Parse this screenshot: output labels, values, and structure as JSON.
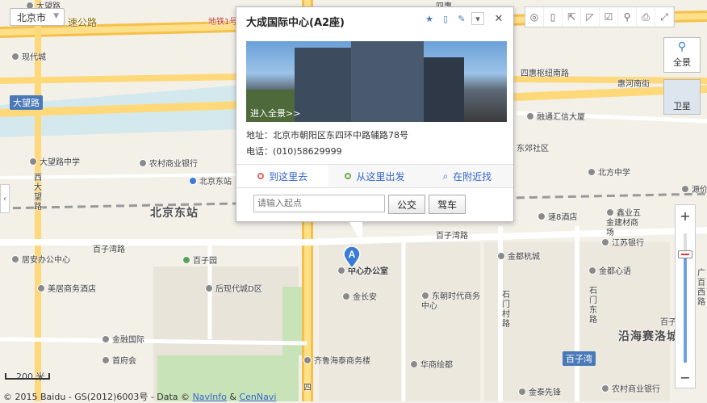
{
  "map": {
    "roads": [
      {
        "name": "大望路",
        "type": "shield-blue"
      },
      {
        "name": "西大望路",
        "type": "vertical"
      },
      {
        "name": "速公路",
        "type": "highway"
      },
      {
        "name": "惠河南街",
        "type": "street"
      },
      {
        "name": "百子湾路",
        "type": "street"
      },
      {
        "name": "百子湾路",
        "type": "street"
      },
      {
        "name": "四惠枢纽南路",
        "type": "street"
      },
      {
        "name": "石门村路",
        "type": "vertical"
      },
      {
        "name": "石门东路",
        "type": "vertical"
      },
      {
        "name": "四",
        "type": "vertical"
      }
    ],
    "districts": [
      {
        "name": "北京东站"
      },
      {
        "name": "沿海赛洛城"
      },
      {
        "name": "百子湾",
        "type": "shield-blue"
      }
    ],
    "pois": [
      {
        "name": "大望路"
      },
      {
        "name": "现代城"
      },
      {
        "name": "大望路中学"
      },
      {
        "name": "农村商业银行"
      },
      {
        "name": "北京东站"
      },
      {
        "name": "百子园"
      },
      {
        "name": "居安办公中心"
      },
      {
        "name": "美居商务酒店"
      },
      {
        "name": "后现代城D区"
      },
      {
        "name": "金融国际"
      },
      {
        "name": "首府会"
      },
      {
        "name": "金长安"
      },
      {
        "name": "东朝时代商务中心"
      },
      {
        "name": "齐鲁海泰商务楼"
      },
      {
        "name": "华商绘都"
      },
      {
        "name": "金都杭城"
      },
      {
        "name": "金都心语"
      },
      {
        "name": "江苏银行"
      },
      {
        "name": "金泰先锋"
      },
      {
        "name": "农村商业银行"
      },
      {
        "name": "速8酒店"
      },
      {
        "name": "鑫业五金建材商场"
      },
      {
        "name": "北方中学"
      },
      {
        "name": "融通汇信大厦"
      },
      {
        "name": "东郊社区"
      },
      {
        "name": "源价"
      },
      {
        "name": "广百西路"
      },
      {
        "name": "百子"
      },
      {
        "name": "中心办公室"
      },
      {
        "name": "四惠"
      },
      {
        "name": "地铁1号"
      }
    ],
    "city_select": "北京市",
    "scale_label": "200 米",
    "copyright_prefix": "© 2015 Baidu - GS(2012)6003号 - Data ©",
    "copyright_link1": "NavInfo",
    "copyright_amp": "&",
    "copyright_link2": "CenNavi"
  },
  "popup": {
    "title": "大成国际中心(A2座)",
    "pano_label": "进入全景>>",
    "address_label": "地址：",
    "address": "北京市朝阳区东四环中路辅路78号",
    "phone_label": "电话：",
    "phone": "(010)58629999",
    "tabs": [
      {
        "label": "到这里去",
        "color": "#e06666"
      },
      {
        "label": "从这里出发",
        "color": "#6ab04c"
      },
      {
        "label": "在附近找",
        "icon": "search-icon"
      }
    ],
    "start_placeholder": "请输入起点",
    "bus_label": "公交",
    "drive_label": "驾车"
  },
  "marker_letter": "A",
  "side_buttons": {
    "panorama": "全景",
    "satellite": "卫星"
  },
  "zoom": {
    "plus": "+",
    "minus": "−"
  }
}
